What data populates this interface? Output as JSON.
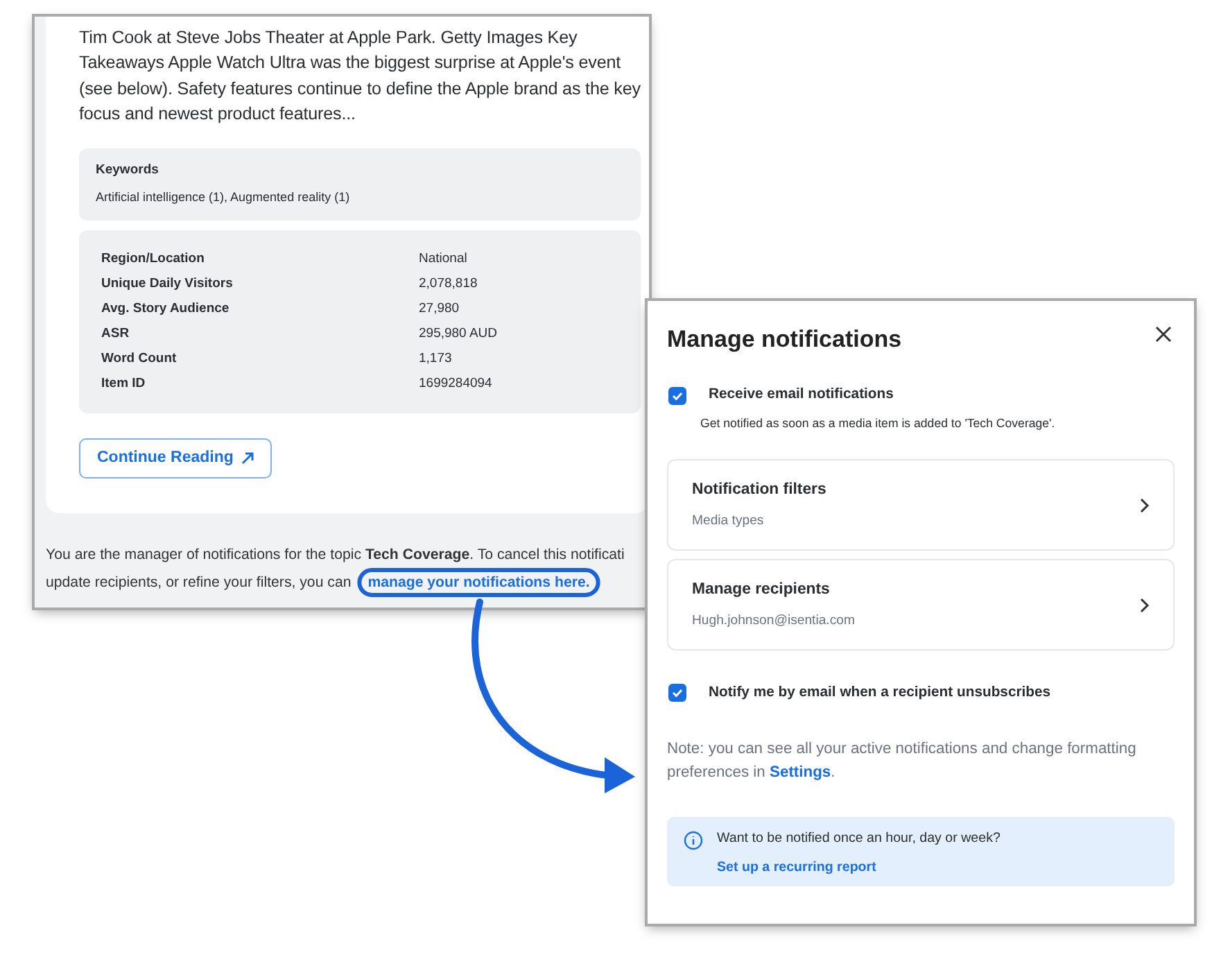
{
  "article": {
    "summary": "Tim Cook at Steve Jobs Theater at Apple Park. Getty Images Key Takeaways Apple Watch Ultra was the biggest surprise at Apple's event (see below). Safety features continue to define the Apple brand as the key focus and newest product features...",
    "keywords": {
      "label": "Keywords",
      "value": "Artificial intelligence (1), Augmented reality (1)"
    },
    "stats": [
      {
        "label": "Region/Location",
        "value": "National"
      },
      {
        "label": "Unique Daily Visitors",
        "value": "2,078,818"
      },
      {
        "label": "Avg. Story Audience",
        "value": "27,980"
      },
      {
        "label": "ASR",
        "value": "295,980 AUD"
      },
      {
        "label": "Word Count",
        "value": "1,173"
      },
      {
        "label": "Item ID",
        "value": "1699284094"
      }
    ],
    "button": "Continue Reading"
  },
  "footer": {
    "line_1": "You are the manager of notifications for the topic **Tech Coverage**. To cancel this notificati",
    "line_2": "update recipients, or refine your filters, you can",
    "link": "manage your notifications here."
  },
  "dialog": {
    "title": "Manage notifications",
    "email_option": {
      "label": "Receive email notifications",
      "checked": true,
      "hint": "Get notified as soon as a media item is added to 'Tech Coverage'."
    },
    "links": [
      {
        "title": "Notification filters",
        "subtitle": "Media types"
      },
      {
        "title": "Manage recipients",
        "subtitle": "Hugh.johnson@isentia.com"
      }
    ],
    "unsubscribe_option": {
      "label": "Notify me by email when a recipient unsubscribes",
      "checked": true
    },
    "note": "Note: you can see all your active notifications and change formatting preferences in",
    "note_link": "Settings",
    "note_end": ".",
    "info": {
      "text": "Want to be notified once an hour, day or week?",
      "link": "Set up a recurring report"
    }
  }
}
